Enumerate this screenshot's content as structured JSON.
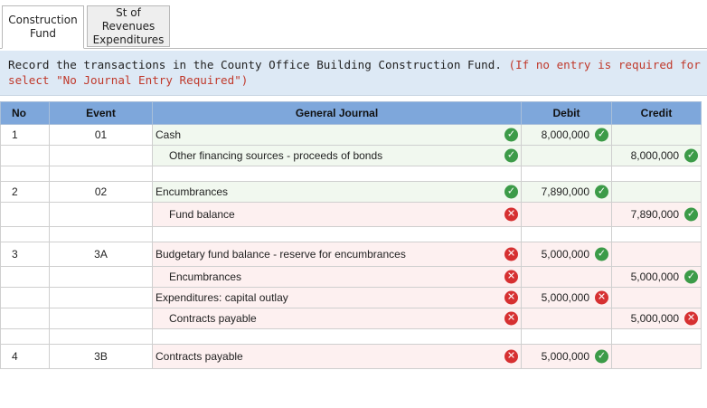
{
  "tabs": [
    {
      "label": "Construction Fund",
      "lines": [
        "Construction",
        "Fund"
      ]
    },
    {
      "label": "St of Revenues Expenditures",
      "lines": [
        "St of",
        "Revenues",
        "Expenditures"
      ]
    }
  ],
  "instruction": {
    "text": "Record the transactions in the County Office Building Construction Fund.",
    "note_line1": "(If no entry is required for a transaction/event,",
    "note_line2": "select \"No Journal Entry Required\")"
  },
  "columns": {
    "no": "No",
    "event": "Event",
    "general_journal": "General Journal",
    "debit": "Debit",
    "credit": "Credit"
  },
  "rows": [
    {
      "no": "1",
      "event": "01",
      "account": "Cash",
      "indent": false,
      "account_status": "correct",
      "debit": "8,000,000",
      "debit_status": "correct",
      "credit": "",
      "credit_status": ""
    },
    {
      "no": "",
      "event": "",
      "account": "Other financing sources - proceeds of bonds",
      "indent": true,
      "account_status": "correct",
      "debit": "",
      "debit_status": "",
      "credit": "8,000,000",
      "credit_status": "correct"
    },
    {
      "no": "2",
      "event": "02",
      "account": "Encumbrances",
      "indent": false,
      "account_status": "correct",
      "debit": "7,890,000",
      "debit_status": "correct",
      "credit": "",
      "credit_status": ""
    },
    {
      "no": "",
      "event": "",
      "account": "Fund balance",
      "indent": true,
      "account_status": "incorrect",
      "debit": "",
      "debit_status": "",
      "credit": "7,890,000",
      "credit_status": "correct"
    },
    {
      "no": "3",
      "event": "3A",
      "account": "Budgetary fund balance - reserve for encumbrances",
      "indent": false,
      "account_status": "incorrect",
      "debit": "5,000,000",
      "debit_status": "correct",
      "credit": "",
      "credit_status": ""
    },
    {
      "no": "",
      "event": "",
      "account": "Encumbrances",
      "indent": true,
      "account_status": "incorrect",
      "debit": "",
      "debit_status": "",
      "credit": "5,000,000",
      "credit_status": "correct"
    },
    {
      "no": "",
      "event": "",
      "account": "Expenditures: capital outlay",
      "indent": false,
      "account_status": "incorrect",
      "debit": "5,000,000",
      "debit_status": "incorrect",
      "credit": "",
      "credit_status": ""
    },
    {
      "no": "",
      "event": "",
      "account": "Contracts payable",
      "indent": true,
      "account_status": "incorrect",
      "debit": "",
      "debit_status": "",
      "credit": "5,000,000",
      "credit_status": "incorrect"
    },
    {
      "no": "4",
      "event": "3B",
      "account": "Contracts payable",
      "indent": false,
      "account_status": "incorrect",
      "debit": "5,000,000",
      "debit_status": "correct",
      "credit": "",
      "credit_status": ""
    }
  ],
  "colors": {
    "header_bg": "#7ea7db",
    "banner_bg": "#dde9f5",
    "correct": "#3c9b48",
    "incorrect": "#d63031",
    "note_text": "#c0392b"
  },
  "icons": {
    "correct": "check-circle-icon",
    "incorrect": "x-circle-icon"
  }
}
